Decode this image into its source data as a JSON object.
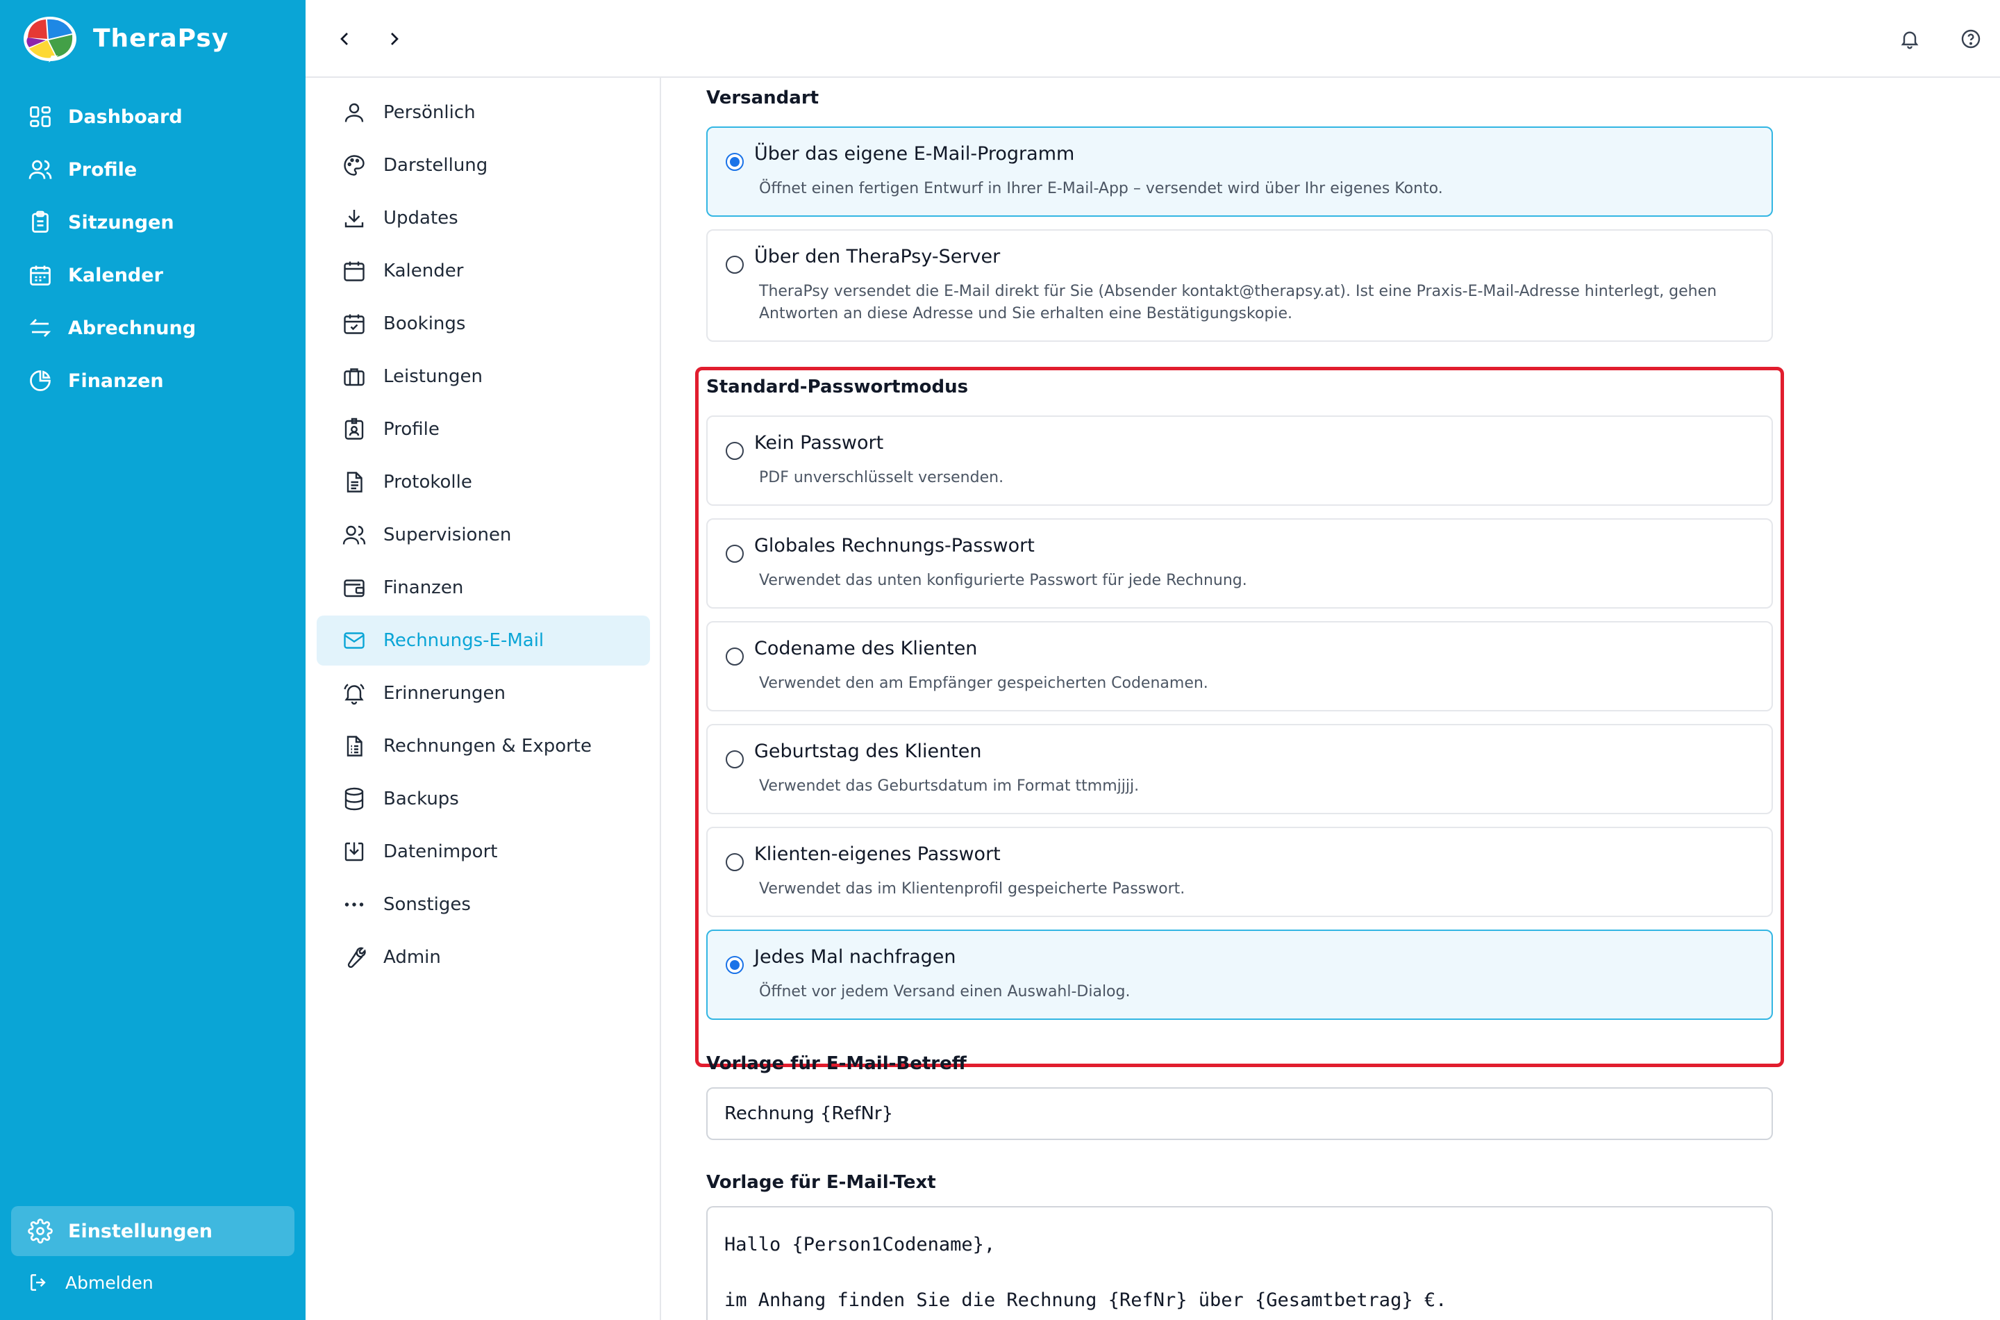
{
  "app": {
    "name": "TheraPsy"
  },
  "colors": {
    "sidebar": "#0aa5d6",
    "accent": "#0aa5d6",
    "radio_selected": "#1a73e8",
    "highlight": "#e11d2e"
  },
  "sidebar": {
    "items": [
      {
        "label": "Dashboard",
        "icon": "dashboard-icon"
      },
      {
        "label": "Profile",
        "icon": "users-icon"
      },
      {
        "label": "Sitzungen",
        "icon": "clipboard-icon"
      },
      {
        "label": "Kalender",
        "icon": "calendar-icon"
      },
      {
        "label": "Abrechnung",
        "icon": "arrows-exchange-icon"
      },
      {
        "label": "Finanzen",
        "icon": "pie-chart-icon"
      }
    ],
    "settings_label": "Einstellungen",
    "logout_label": "Abmelden"
  },
  "topbar": {
    "back": "chevron-left-icon",
    "forward": "chevron-right-icon",
    "notifications": "bell-icon",
    "help": "help-circle-icon"
  },
  "submenu": {
    "items": [
      {
        "label": "Persönlich",
        "icon": "user-icon"
      },
      {
        "label": "Darstellung",
        "icon": "palette-icon"
      },
      {
        "label": "Updates",
        "icon": "download-icon"
      },
      {
        "label": "Kalender",
        "icon": "calendar-icon"
      },
      {
        "label": "Bookings",
        "icon": "calendar-check-icon"
      },
      {
        "label": "Leistungen",
        "icon": "briefcase-icon"
      },
      {
        "label": "Profile",
        "icon": "id-badge-icon"
      },
      {
        "label": "Protokolle",
        "icon": "document-icon"
      },
      {
        "label": "Supervisionen",
        "icon": "users-icon"
      },
      {
        "label": "Finanzen",
        "icon": "wallet-icon"
      },
      {
        "label": "Rechnungs-E-Mail",
        "icon": "mail-icon",
        "active": true
      },
      {
        "label": "Erinnerungen",
        "icon": "bell-ring-icon"
      },
      {
        "label": "Rechnungen & Exporte",
        "icon": "invoice-icon"
      },
      {
        "label": "Backups",
        "icon": "database-icon"
      },
      {
        "label": "Datenimport",
        "icon": "import-icon"
      },
      {
        "label": "Sonstiges",
        "icon": "more-horizontal-icon"
      },
      {
        "label": "Admin",
        "icon": "wrench-icon"
      }
    ]
  },
  "versand": {
    "label": "Versandart",
    "options": [
      {
        "title": "Über das eigene E-Mail-Programm",
        "desc": "Öffnet einen fertigen Entwurf in Ihrer E-Mail-App – versendet wird über Ihr eigenes Konto.",
        "selected": true
      },
      {
        "title": "Über den TheraPsy-Server",
        "desc": "TheraPsy versendet die E-Mail direkt für Sie (Absender kontakt@therapsy.at). Ist eine Praxis-E-Mail-Adresse hinterlegt, gehen Antworten an diese Adresse und Sie erhalten eine Bestätigungskopie.",
        "selected": false
      }
    ]
  },
  "passwort": {
    "label": "Standard-Passwortmodus",
    "options": [
      {
        "title": "Kein Passwort",
        "desc": "PDF unverschlüsselt versenden.",
        "selected": false
      },
      {
        "title": "Globales Rechnungs-Passwort",
        "desc": "Verwendet das unten konfigurierte Passwort für jede Rechnung.",
        "selected": false
      },
      {
        "title": "Codename des Klienten",
        "desc": "Verwendet den am Empfänger gespeicherten Codenamen.",
        "selected": false
      },
      {
        "title": "Geburtstag des Klienten",
        "desc": "Verwendet das Geburtsdatum im Format ttmmjjjj.",
        "selected": false
      },
      {
        "title": "Klienten-eigenes Passwort",
        "desc": "Verwendet das im Klientenprofil gespeicherte Passwort.",
        "selected": false
      },
      {
        "title": "Jedes Mal nachfragen",
        "desc": "Öffnet vor jedem Versand einen Auswahl-Dialog.",
        "selected": true
      }
    ]
  },
  "betreff": {
    "label": "Vorlage für E-Mail-Betreff",
    "value": "Rechnung {RefNr}"
  },
  "text": {
    "label": "Vorlage für E-Mail-Text",
    "line1": "Hallo {Person1Codename},",
    "line2": "im Anhang finden Sie die Rechnung {RefNr} über {Gesamtbetrag} €."
  }
}
